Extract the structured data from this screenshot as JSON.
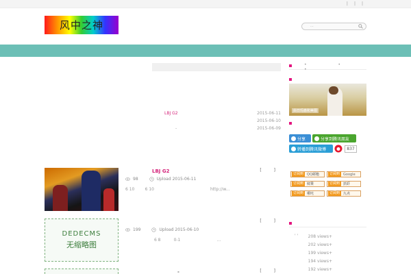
{
  "topbar": {
    "links": [
      "|",
      "|",
      "|"
    ]
  },
  "logo": {
    "text": "风中之神"
  },
  "search": {
    "placeholder": "..."
  },
  "latest": [
    {
      "title": "LBJ G2",
      "date": "2015-06-11"
    },
    {
      "title": "",
      "date": "2015-06-10"
    },
    {
      "title": "-",
      "date": "2015-06-09"
    }
  ],
  "posts": [
    {
      "title": "LBJ G2",
      "brackets": "[ ]",
      "views": "98",
      "upload": "Upload 2015-06-11",
      "excerpt": "6 10        6 10                                           http://w..."
    },
    {
      "title": "",
      "brackets": "[ ]",
      "views": "199",
      "upload": "Upload 2015-06-10",
      "excerpt": "                      6 8          0-1                            ...",
      "thumb_line1": "DEDECMS",
      "thumb_line2": "无缩略图"
    },
    {
      "title": "-",
      "brackets": "[ ]"
    }
  ],
  "sidebar": {
    "head1_dots": "• • •",
    "photo_caption": "由日玛森和美图",
    "share": {
      "btn1": "分享",
      "btn2": "分享到腾讯朋友",
      "btn3": "转播到腾讯微博",
      "count": "837"
    },
    "subscribe": [
      {
        "tag": "订阅到",
        "name": "QQ邮箱"
      },
      {
        "tag": "订阅到",
        "name": "Google"
      },
      {
        "tag": "订阅到",
        "name": "鲜果"
      },
      {
        "tag": "订阅到",
        "name": "抓虾"
      },
      {
        "tag": "订阅到",
        "name": "哪吒"
      },
      {
        "tag": "订阅到",
        "name": "九点"
      }
    ],
    "hot_dots": "' '",
    "hot": [
      "208 views+",
      "202 views+",
      "199 views+",
      "194 views+",
      "192 views+"
    ]
  },
  "colors": {
    "nav": "#6cbfb6",
    "accent": "#e3157f",
    "title": "#d4237a"
  }
}
